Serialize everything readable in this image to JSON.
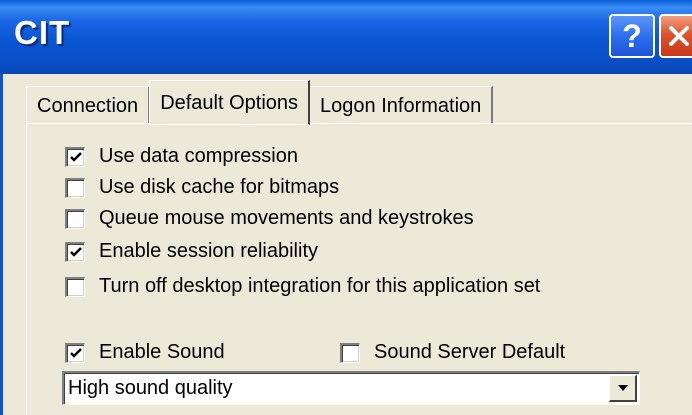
{
  "window": {
    "title": "CIT",
    "help_label": "?"
  },
  "tabs": [
    {
      "label": "Connection",
      "active": false
    },
    {
      "label": "Default Options",
      "active": true
    },
    {
      "label": "Logon Information",
      "active": false
    }
  ],
  "options": {
    "use_data_compression": {
      "label": "Use data compression",
      "checked": true
    },
    "use_disk_cache": {
      "label": "Use disk cache for bitmaps",
      "checked": false
    },
    "queue_mouse": {
      "label": "Queue mouse movements and keystrokes",
      "checked": false
    },
    "session_reliability": {
      "label": "Enable session reliability",
      "checked": true
    },
    "desktop_integration": {
      "label": "Turn off desktop integration for this application set",
      "checked": false
    },
    "enable_sound": {
      "label": "Enable Sound",
      "checked": true
    },
    "sound_server_default": {
      "label": "Sound Server Default",
      "checked": false
    }
  },
  "sound_quality": {
    "value": "High sound quality"
  },
  "colors": {
    "titlebar": "#0a55d4",
    "dialog_bg": "#ece9d8",
    "close_red": "#e0532e"
  },
  "icons": {
    "help": "question-mark",
    "close": "x",
    "check": "checkmark",
    "dropdown": "triangle-down"
  }
}
